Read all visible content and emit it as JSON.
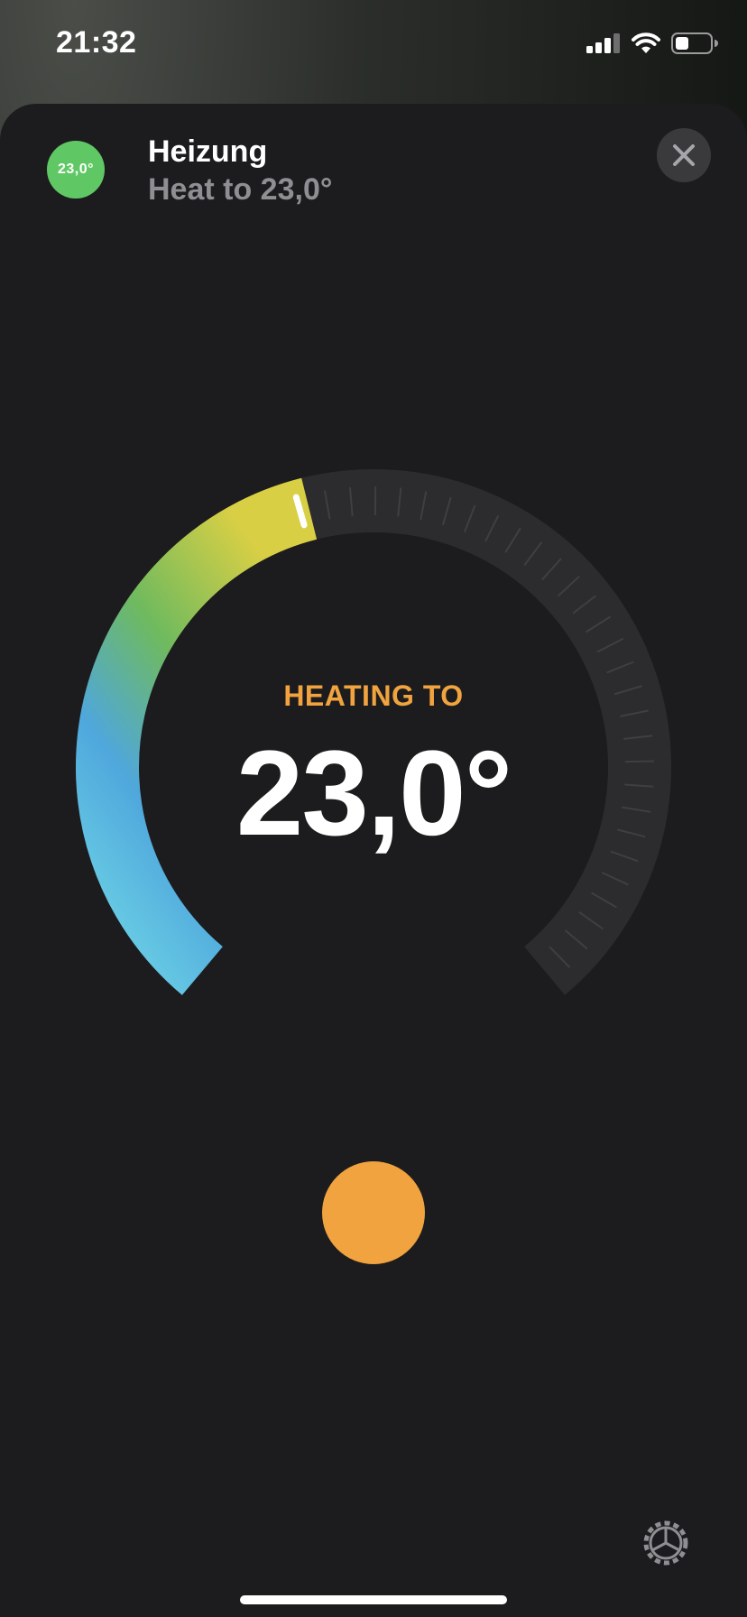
{
  "status_bar": {
    "time": "21:32",
    "icons": [
      "cellular-signal-icon",
      "wifi-icon",
      "battery-icon"
    ]
  },
  "header": {
    "badge_value": "23,0°",
    "badge_color": "#5fc864",
    "title": "Heizung",
    "subtitle": "Heat to 23,0°",
    "close_icon": "close-icon"
  },
  "thermostat": {
    "mode_label": "HEATING TO",
    "target_temperature": "23,0°",
    "accent_color": "#f0a33f",
    "dial_fraction": 0.45,
    "gradient_colors": [
      "#6fd6e6",
      "#4fa7dc",
      "#6fba5e",
      "#d8cf45"
    ]
  },
  "controls": {
    "mode_button_color": "#f0a33f",
    "settings_icon": "gear-icon"
  }
}
